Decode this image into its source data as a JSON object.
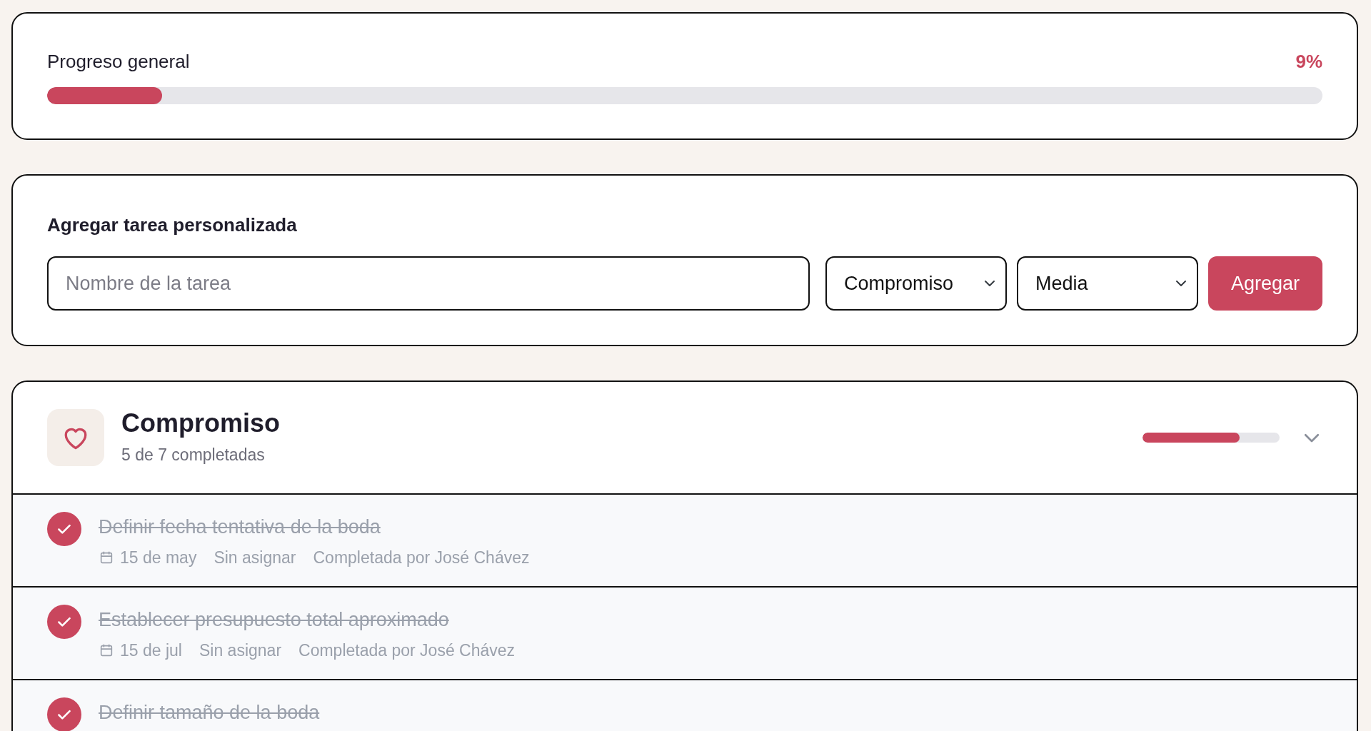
{
  "overall_progress": {
    "label": "Progreso general",
    "percent": "9%",
    "level": 0.09
  },
  "add_task": {
    "title": "Agregar tarea personalizada",
    "name_field": {
      "placeholder": "Nombre de la tarea"
    },
    "category_select": {
      "value": "Compromiso"
    },
    "priority_select": {
      "value": "Media"
    },
    "button": "Agregar"
  },
  "categories": [
    {
      "name": "Compromiso",
      "summary": "5 de 7 completadas",
      "level": 0.71,
      "expanded": true,
      "tasks": [
        {
          "title": "Definir fecha tentativa de la boda",
          "completed": true,
          "date": "15 de may",
          "assignee": "Sin asignar",
          "completed_by": "Completada por José Chávez"
        },
        {
          "title": "Establecer presupuesto total aproximado",
          "completed": true,
          "date": "15 de jul",
          "assignee": "Sin asignar",
          "completed_by": "Completada por José Chávez"
        },
        {
          "title": "Definir tamaño de la boda",
          "completed": true
        }
      ]
    }
  ]
}
